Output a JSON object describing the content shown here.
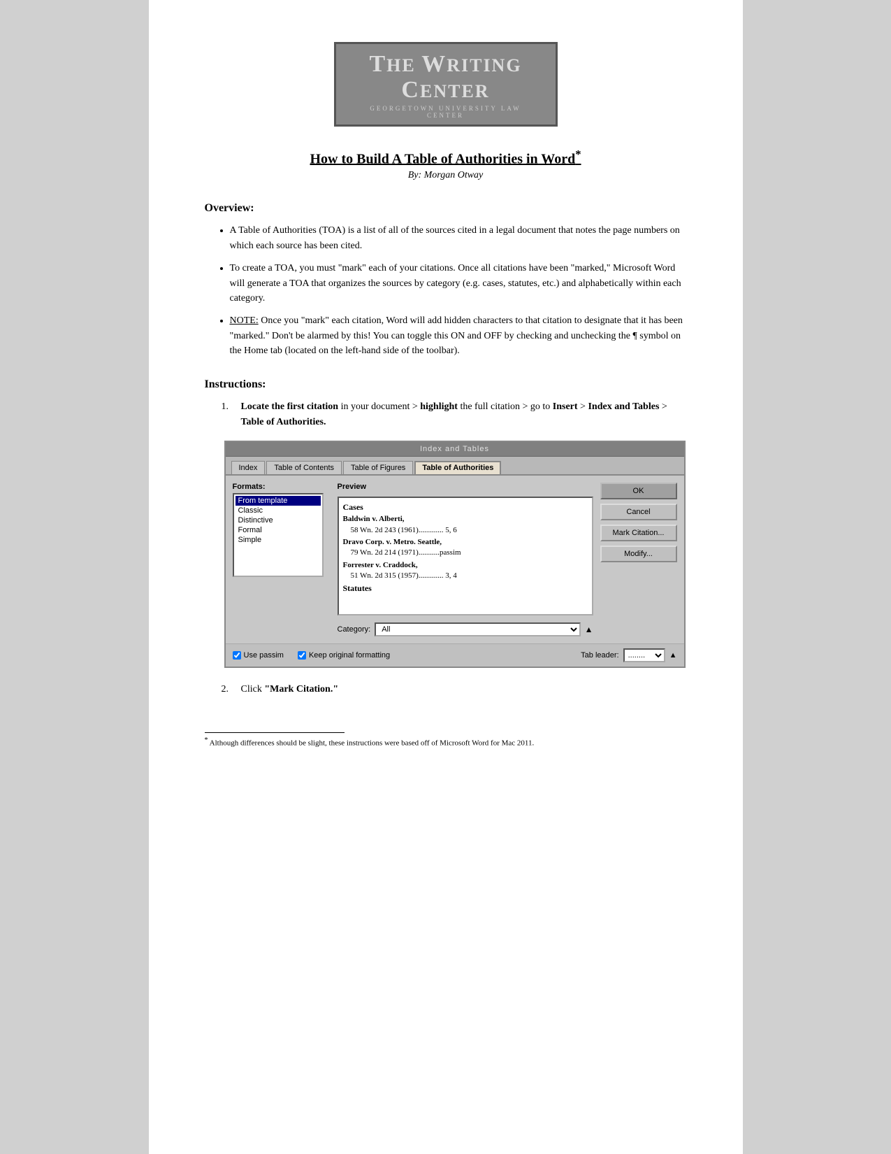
{
  "logo": {
    "title_part1": "The ",
    "title_w": "W",
    "title_part2": "riting ",
    "title_c": "C",
    "title_part3": "enter",
    "subtitle": "Georgetown University Law Center"
  },
  "page_title": "How to Build A Table of Authorities in Word",
  "page_title_footnote": "*",
  "byline": "By: Morgan Otway",
  "sections": {
    "overview": {
      "header": "Overview:",
      "bullets": [
        "A Table of Authorities (TOA) is a list of all of the sources cited in a legal document that notes the page numbers on which each source has been cited.",
        "To create a TOA, you must \"mark\" each of your citations. Once all citations have been \"marked,\" Microsoft Word will generate a TOA that organizes the sources by category (e.g. cases, statutes, etc.) and alphabetically within each category.",
        "NOTE: Once you \"mark\" each citation, Word will add hidden characters to that citation to designate that it has been \"marked.\" Don't be alarmed by this! You can toggle this ON and OFF by checking and unchecking the ¶ symbol on the Home tab (located on the left-hand side of the toolbar)."
      ],
      "note_label": "NOTE:"
    },
    "instructions": {
      "header": "Instructions:",
      "step1_prefix": "Locate the first citation",
      "step1_mid1": " in your document > ",
      "step1_bold2": "highlight",
      "step1_mid2": " the full citation > go to ",
      "step1_bold3": "Insert",
      "step1_mid3": " > ",
      "step1_bold4": "Index and Tables",
      "step1_mid4": " > ",
      "step1_bold5": "Table of Authorities.",
      "step2_text": "Click ",
      "step2_bold": "\"Mark Citation.\""
    }
  },
  "dialog": {
    "title": "Index and Tables",
    "tabs": [
      "Index",
      "Table of Contents",
      "Table of Figures",
      "Table of Authorities"
    ],
    "active_tab": "Table of Authorities",
    "formats_label": "Formats:",
    "formats": [
      "From template",
      "Classic",
      "Distinctive",
      "Formal",
      "Simple"
    ],
    "selected_format": "From template",
    "preview_label": "Preview",
    "preview_category": "Cases",
    "preview_entries": [
      {
        "name": "Baldwin v. Alberti,",
        "detail": "58 Wn. 2d 243 (1961)............. 5, 6"
      },
      {
        "name": "Dravo Corp. v. Metro. Seattle,",
        "detail": "79 Wn. 2d 214 (1971)...........passim"
      },
      {
        "name": "Forrester v. Craddock,",
        "detail": "51 Wn. 2d 315 (1957)............. 3, 4"
      }
    ],
    "preview_category2": "Statutes",
    "category_label": "Category:",
    "category_value": "All",
    "buttons": {
      "ok": "OK",
      "cancel": "Cancel",
      "mark_citation": "Mark Citation...",
      "modify": "Modify..."
    },
    "checkboxes": {
      "use_passim": "Use passim",
      "keep_formatting": "Keep original formatting"
    },
    "tab_leader_label": "Tab leader:",
    "tab_leader_value": "........"
  },
  "footer": {
    "footnote_symbol": "*",
    "footnote_text": "Although differences should be slight, these instructions were based off of Microsoft Word for Mac 2011."
  }
}
